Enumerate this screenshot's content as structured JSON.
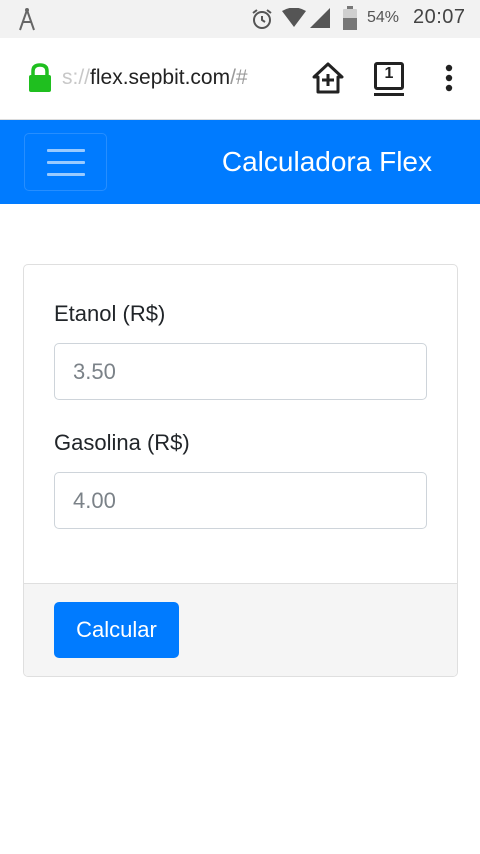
{
  "status_bar": {
    "battery_percent": "54%",
    "time": "20:07"
  },
  "browser": {
    "url_prefix": "s://",
    "url_host": "flex.sepbit.com",
    "url_suffix": "/#",
    "tab_count": "1"
  },
  "navbar": {
    "brand": "Calculadora Flex"
  },
  "form": {
    "etanol_label": "Etanol (R$)",
    "etanol_placeholder": "3.50",
    "gasolina_label": "Gasolina (R$)",
    "gasolina_placeholder": "4.00",
    "submit_label": "Calcular"
  },
  "colors": {
    "primary": "#007bff",
    "lock_green": "#1fbf1f"
  }
}
